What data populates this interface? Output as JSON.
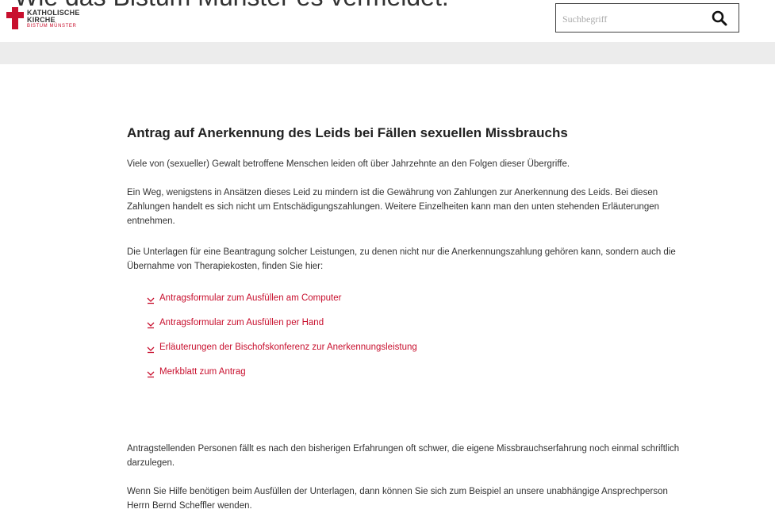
{
  "header": {
    "cutoff_headline": "Wie das Bistum Münster es vermeldet.",
    "logo": {
      "line1": "KATHOLISCHE",
      "line2": "KIRCHE",
      "line3": "BISTUM MÜNSTER"
    },
    "search": {
      "placeholder": "Suchbegriff",
      "icon": "search-icon"
    }
  },
  "main": {
    "title": "Antrag auf Anerkennung des Leids bei Fällen sexuellen Missbrauchs",
    "paragraphs": [
      "Viele von (sexueller) Gewalt betroffene Menschen leiden oft über Jahrzehnte an den Folgen dieser Übergriffe.",
      "Ein Weg, wenigstens in Ansätzen dieses Leid zu mindern ist die Gewährung von Zahlungen zur Anerkennung des Leids. Bei diesen Zahlungen handelt es sich nicht um Entschädigungszahlungen. Weitere Einzelheiten kann man den unten stehenden Erläuterungen entnehmen.",
      "Die Unterlagen für eine Beantragung solcher Leistungen, zu denen nicht nur die Anerkennungszahlung gehören kann, sondern auch die Übernahme von Therapiekosten, finden Sie hier:"
    ],
    "links": [
      {
        "label": "Antragsformular zum Ausfüllen am Computer",
        "icon": "download-icon"
      },
      {
        "label": "Antragsformular zum Ausfüllen per Hand",
        "icon": "download-icon"
      },
      {
        "label": "Erläuterungen der Bischofskonferenz zur Anerkennungsleistung",
        "icon": "download-icon"
      },
      {
        "label": "Merkblatt zum Antrag",
        "icon": "download-icon"
      }
    ],
    "paragraphs_after": [
      "Antragstellenden Personen fällt es nach den bisherigen Erfahrungen oft schwer, die eigene Missbrauchserfahrung noch einmal schriftlich darzulegen.",
      "Wenn Sie Hilfe benötigen beim Ausfüllen der Unterlagen, dann können Sie sich zum Beispiel an unsere unabhängige Ansprechperson Herrn Bernd Scheffler wenden."
    ]
  },
  "colors": {
    "accent": "#c8102e",
    "grey_bar": "#ececec",
    "text": "#333333"
  }
}
